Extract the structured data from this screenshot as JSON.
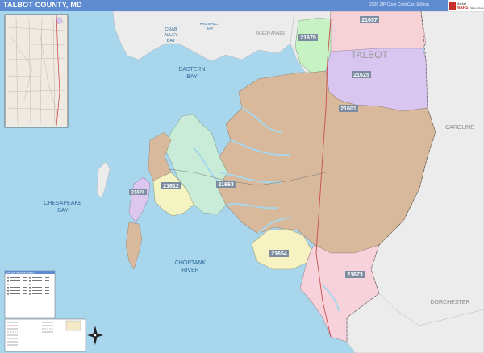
{
  "header": {
    "title": "TALBOT COUNTY, MD",
    "edition": "2026 ZIP Code ColorCast Edition",
    "logo_line1": "Market",
    "logo_line2": "MAPS",
    "logo_line3": "Maps • Data"
  },
  "water_labels": {
    "crab_alley_bay": [
      "CRAB",
      "ALLEY",
      "BAY"
    ],
    "prospect_bay": [
      "PROSPECT",
      "BAY"
    ],
    "eastern_bay": [
      "EASTERN",
      "BAY"
    ],
    "chesapeake_bay": [
      "CHESAPEAKE",
      "BAY"
    ],
    "choptank_river": [
      "CHOPTANK",
      "RIVER"
    ]
  },
  "place_labels": {
    "queen_annes": "QUEEN ANNES",
    "talbot": "TALBOT",
    "caroline": "CAROLINE",
    "dorchester": "DORCHESTER"
  },
  "zip_labels": {
    "z21657": "21657",
    "z21679": "21679",
    "z21625": "21625",
    "z21601": "21601",
    "z21663": "21663",
    "z21612": "21612",
    "z21676": "21676",
    "z21654": "21654",
    "z21673": "21673"
  },
  "colors": {
    "water": "#a8d6ec",
    "land_outside": "#ececec",
    "z21601": "#d9b99c",
    "z21625": "#d9c6f0",
    "z21657": "#f6d2d6",
    "z21679": "#c6f2c4",
    "z21663": "#c8ecd8",
    "z21612": "#f4f3c2",
    "z21676": "#dcc7ee",
    "z21654": "#f6f2c2",
    "z21673": "#f7d2da",
    "title_bar": "#5f8bd0"
  },
  "legend": {
    "header": "ZIP Code Index/Post Location"
  },
  "icons": {
    "compass": "north-arrow-icon"
  }
}
